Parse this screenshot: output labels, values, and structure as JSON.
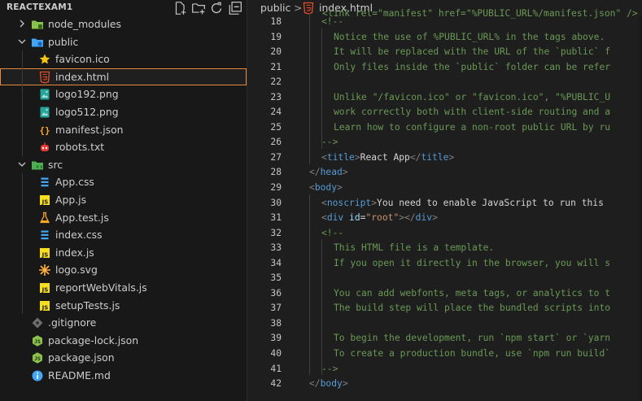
{
  "explorer": {
    "title": "REACTEXAM1",
    "toolbar": [
      {
        "icon": "new-file-icon"
      },
      {
        "icon": "new-folder-icon"
      },
      {
        "icon": "refresh-icon"
      },
      {
        "icon": "collapse-all-icon"
      }
    ],
    "items": [
      {
        "label": "node_modules",
        "level": 1,
        "kind": "folder",
        "expanded": false,
        "icon": "folder-node-icon"
      },
      {
        "label": "public",
        "level": 1,
        "kind": "folder",
        "expanded": true,
        "icon": "folder-public-icon"
      },
      {
        "label": "favicon.ico",
        "level": 2,
        "kind": "file",
        "icon": "star-icon"
      },
      {
        "label": "index.html",
        "level": 2,
        "kind": "file",
        "icon": "html-icon",
        "selected": true
      },
      {
        "label": "logo192.png",
        "level": 2,
        "kind": "file",
        "icon": "image-icon"
      },
      {
        "label": "logo512.png",
        "level": 2,
        "kind": "file",
        "icon": "image-icon"
      },
      {
        "label": "manifest.json",
        "level": 2,
        "kind": "file",
        "icon": "json-braces-icon"
      },
      {
        "label": "robots.txt",
        "level": 2,
        "kind": "file",
        "icon": "robot-icon"
      },
      {
        "label": "src",
        "level": 1,
        "kind": "folder",
        "expanded": true,
        "icon": "folder-src-icon"
      },
      {
        "label": "App.css",
        "level": 2,
        "kind": "file",
        "icon": "css-icon"
      },
      {
        "label": "App.js",
        "level": 2,
        "kind": "file",
        "icon": "js-icon"
      },
      {
        "label": "App.test.js",
        "level": 2,
        "kind": "file",
        "icon": "test-flask-icon"
      },
      {
        "label": "index.css",
        "level": 2,
        "kind": "file",
        "icon": "css-icon"
      },
      {
        "label": "index.js",
        "level": 2,
        "kind": "file",
        "icon": "js-icon"
      },
      {
        "label": "logo.svg",
        "level": 2,
        "kind": "file",
        "icon": "svg-icon"
      },
      {
        "label": "reportWebVitals.js",
        "level": 2,
        "kind": "file",
        "icon": "js-icon"
      },
      {
        "label": "setupTests.js",
        "level": 2,
        "kind": "file",
        "icon": "js-icon"
      },
      {
        "label": ".gitignore",
        "level": 1,
        "kind": "file",
        "icon": "git-icon"
      },
      {
        "label": "package-lock.json",
        "level": 1,
        "kind": "file",
        "icon": "nodejs-icon"
      },
      {
        "label": "package.json",
        "level": 1,
        "kind": "file",
        "icon": "nodejs-icon"
      },
      {
        "label": "README.md",
        "level": 1,
        "kind": "file",
        "icon": "info-icon"
      }
    ]
  },
  "breadcrumb": {
    "folder": "public",
    "separator": ">",
    "file": "index.html",
    "file_icon": "html-icon"
  },
  "editor": {
    "partial_top_line": "<link rel=\"manifest\" href=\"%PUBLIC_URL%/manifest.json\" />",
    "lines": [
      {
        "n": "18",
        "indent": 1,
        "tokens": [
          [
            "c-comment",
            "<!--"
          ]
        ]
      },
      {
        "n": "19",
        "indent": 2,
        "tokens": [
          [
            "c-comment",
            "Notice the use of %PUBLIC_URL% in the tags above."
          ]
        ]
      },
      {
        "n": "20",
        "indent": 2,
        "tokens": [
          [
            "c-comment",
            "It will be replaced with the URL of the `public` f"
          ]
        ]
      },
      {
        "n": "21",
        "indent": 2,
        "tokens": [
          [
            "c-comment",
            "Only files inside the `public` folder can be refer"
          ]
        ]
      },
      {
        "n": "22",
        "indent": 0,
        "tokens": []
      },
      {
        "n": "23",
        "indent": 2,
        "tokens": [
          [
            "c-comment",
            "Unlike \"/favicon.ico\" or \"favicon.ico\", \"%PUBLIC_U"
          ]
        ]
      },
      {
        "n": "24",
        "indent": 2,
        "tokens": [
          [
            "c-comment",
            "work correctly both with client-side routing and a"
          ]
        ]
      },
      {
        "n": "25",
        "indent": 2,
        "tokens": [
          [
            "c-comment",
            "Learn how to configure a non-root public URL by ru"
          ]
        ]
      },
      {
        "n": "26",
        "indent": 1,
        "tokens": [
          [
            "c-comment",
            "-->"
          ]
        ]
      },
      {
        "n": "27",
        "indent": 1,
        "tokens": [
          [
            "c-punc",
            "<"
          ],
          [
            "c-tag",
            "title"
          ],
          [
            "c-punc",
            ">"
          ],
          [
            "c-text",
            "React App"
          ],
          [
            "c-punc",
            "</"
          ],
          [
            "c-tag",
            "title"
          ],
          [
            "c-punc",
            ">"
          ]
        ]
      },
      {
        "n": "28",
        "indent": 0,
        "tokens": [
          [
            "c-punc",
            "</"
          ],
          [
            "c-tag",
            "head"
          ],
          [
            "c-punc",
            ">"
          ]
        ]
      },
      {
        "n": "29",
        "indent": 0,
        "tokens": [
          [
            "c-punc",
            "<"
          ],
          [
            "c-tag",
            "body"
          ],
          [
            "c-punc",
            ">"
          ]
        ]
      },
      {
        "n": "30",
        "indent": 1,
        "tokens": [
          [
            "c-punc",
            "<"
          ],
          [
            "c-tag",
            "noscript"
          ],
          [
            "c-punc",
            ">"
          ],
          [
            "c-text",
            "You need to enable JavaScript to run this"
          ]
        ]
      },
      {
        "n": "31",
        "indent": 1,
        "tokens": [
          [
            "c-punc",
            "<"
          ],
          [
            "c-tag",
            "div"
          ],
          [
            "c-text",
            " "
          ],
          [
            "c-attr",
            "id"
          ],
          [
            "c-text",
            "="
          ],
          [
            "c-str",
            "\"root\""
          ],
          [
            "c-punc",
            "></"
          ],
          [
            "c-tag",
            "div"
          ],
          [
            "c-punc",
            ">"
          ]
        ]
      },
      {
        "n": "32",
        "indent": 1,
        "tokens": [
          [
            "c-comment",
            "<!--"
          ]
        ]
      },
      {
        "n": "33",
        "indent": 2,
        "tokens": [
          [
            "c-comment",
            "This HTML file is a template."
          ]
        ]
      },
      {
        "n": "34",
        "indent": 2,
        "tokens": [
          [
            "c-comment",
            "If you open it directly in the browser, you will s"
          ]
        ]
      },
      {
        "n": "35",
        "indent": 0,
        "tokens": []
      },
      {
        "n": "36",
        "indent": 2,
        "tokens": [
          [
            "c-comment",
            "You can add webfonts, meta tags, or analytics to t"
          ]
        ]
      },
      {
        "n": "37",
        "indent": 2,
        "tokens": [
          [
            "c-comment",
            "The build step will place the bundled scripts into"
          ]
        ]
      },
      {
        "n": "38",
        "indent": 0,
        "tokens": []
      },
      {
        "n": "39",
        "indent": 2,
        "tokens": [
          [
            "c-comment",
            "To begin the development, run `npm start` or `yarn"
          ]
        ]
      },
      {
        "n": "40",
        "indent": 2,
        "tokens": [
          [
            "c-comment",
            "To create a production bundle, use `npm run build`"
          ]
        ]
      },
      {
        "n": "41",
        "indent": 1,
        "tokens": [
          [
            "c-comment",
            "-->"
          ]
        ]
      },
      {
        "n": "42",
        "indent": 0,
        "tokens": [
          [
            "c-punc",
            "</"
          ],
          [
            "c-tag",
            "body"
          ],
          [
            "c-punc",
            ">"
          ]
        ]
      }
    ]
  },
  "colors": {
    "background": "#1e1e1e",
    "sidebar": "#181818",
    "selection_border": "#e7883c",
    "comment": "#6a9955",
    "tag": "#569cd6",
    "string": "#ce9178",
    "attribute": "#9cdcfe"
  }
}
